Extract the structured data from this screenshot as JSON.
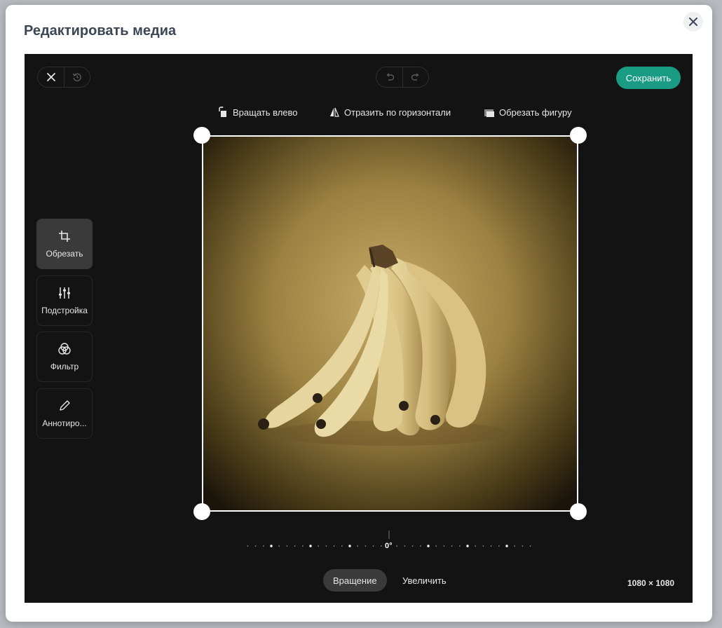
{
  "modal": {
    "title": "Редактировать медиа"
  },
  "toolbar": {
    "save_label": "Сохранить"
  },
  "top_tools": [
    {
      "label": "Вращать влево",
      "icon": "rotate-left-icon"
    },
    {
      "label": "Отразить по горизонтали",
      "icon": "flip-horizontal-icon"
    },
    {
      "label": "Обрезать фигуру",
      "icon": "crop-shape-icon"
    }
  ],
  "sidebar": {
    "items": [
      {
        "label": "Обрезать",
        "icon": "crop-icon",
        "active": true
      },
      {
        "label": "Подстройка",
        "icon": "sliders-icon",
        "active": false
      },
      {
        "label": "Фильтр",
        "icon": "filter-circles-icon",
        "active": false
      },
      {
        "label": "Аннотиро...",
        "icon": "pencil-icon",
        "active": false
      }
    ]
  },
  "rotation": {
    "value": "0°"
  },
  "tabs": [
    {
      "label": "Вращение",
      "active": true
    },
    {
      "label": "Увеличить",
      "active": false
    }
  ],
  "image": {
    "dimensions": "1080 × 1080"
  },
  "colors": {
    "accent": "#1a9b84",
    "editor_bg": "#131313",
    "active_tool_bg": "#3a3a3a"
  }
}
